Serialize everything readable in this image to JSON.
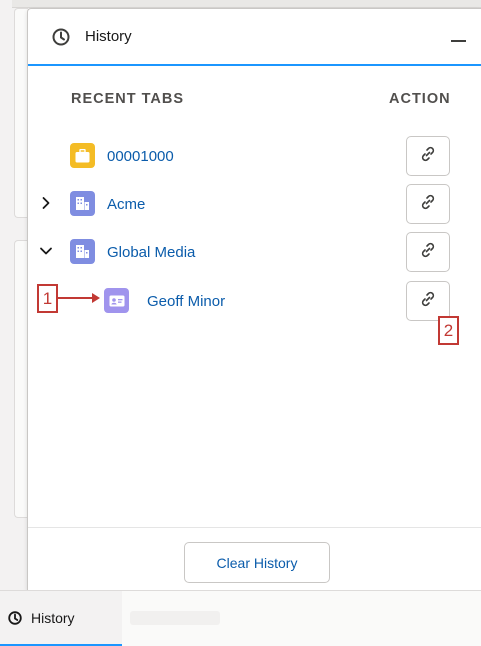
{
  "panel": {
    "title": "History",
    "title_icon": "clock-icon",
    "minimize_icon": "minimize-icon"
  },
  "table": {
    "col_recent": "RECENT TABS",
    "col_action": "ACTION",
    "rows": [
      {
        "label": "00001000",
        "icon": "case-briefcase-icon",
        "icon_color": "#f4bc25",
        "expander": "none",
        "action_icon": "link-icon"
      },
      {
        "label": "Acme",
        "icon": "account-building-icon",
        "icon_color": "#7f8de1",
        "expander": "collapsed",
        "action_icon": "link-icon"
      },
      {
        "label": "Global Media",
        "icon": "account-building-icon",
        "icon_color": "#7f8de1",
        "expander": "expanded",
        "action_icon": "link-icon"
      },
      {
        "label": "Geoff Minor",
        "icon": "contact-card-icon",
        "icon_color": "#a094ed",
        "expander": "none",
        "action_icon": "link-icon"
      }
    ]
  },
  "footer": {
    "clear_label": "Clear History"
  },
  "callouts": {
    "one": "1",
    "two": "2"
  },
  "utility_bar": {
    "tab_label": "History",
    "tab_icon": "clock-icon"
  },
  "colors": {
    "accent_blue": "#1b96ff",
    "link_blue": "#0b5cab",
    "callout_red": "#c23934"
  }
}
